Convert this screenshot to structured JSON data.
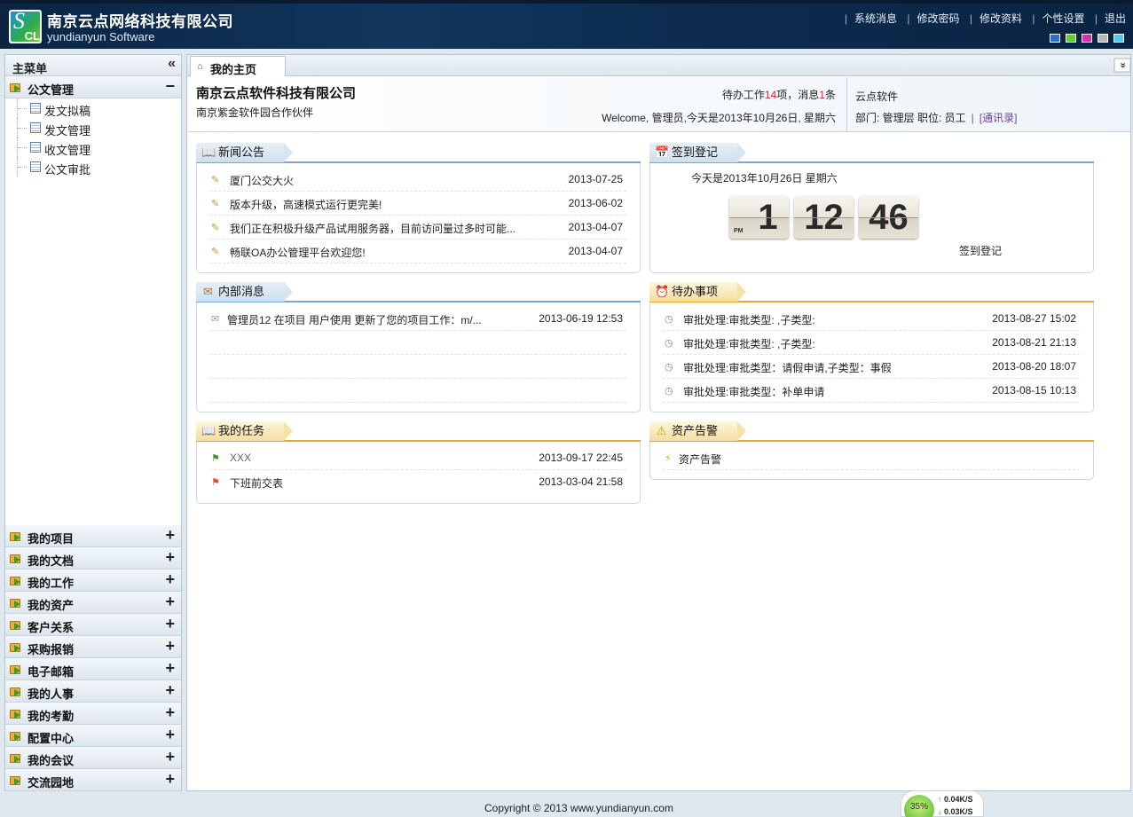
{
  "header": {
    "company_name": "南京云点网络科技有限公司",
    "company_sub": "yundianyun Software",
    "logo_text": "CL",
    "links": [
      "系统消息",
      "修改密码",
      "修改资料",
      "个性设置",
      "退出"
    ],
    "skin_colors": [
      "#2a6fd0",
      "#5fcf2e",
      "#d62fb8",
      "#b8b8b8",
      "#4fc9f0"
    ]
  },
  "sidebar": {
    "title": "主菜单",
    "collapse_icon": "«",
    "open_group": {
      "label": "公文管理",
      "toggle": "−",
      "items": [
        "发文拟稿",
        "发文管理",
        "收文管理",
        "公文审批"
      ]
    },
    "groups": [
      "我的项目",
      "我的文档",
      "我的工作",
      "我的资产",
      "客户关系",
      "采购报销",
      "电子邮箱",
      "我的人事",
      "我的考勤",
      "配置中心",
      "我的会议",
      "交流园地"
    ],
    "expand_icon": "+"
  },
  "tabs": {
    "active": "我的主页",
    "dropdown_icon": "»"
  },
  "info": {
    "company": "南京云点软件科技有限公司",
    "partner": "南京紫金软件园合作伙伴",
    "todo_prefix": "待办工作",
    "todo_count": "14",
    "todo_mid": "项，消息",
    "msg_count": "1",
    "msg_suffix": "条",
    "welcome": "Welcome, 管理员,今天是2013年10月26日, 星期六",
    "org": "云点软件",
    "dept_pos": "部门: 管理层 职位: 员工",
    "contacts_link": "[通讯录]"
  },
  "news": {
    "title": "新闻公告",
    "items": [
      {
        "text": "厦门公交大火",
        "date": "2013-07-25"
      },
      {
        "text": "版本升级，高速模式运行更完美!",
        "date": "2013-06-02"
      },
      {
        "text": "我们正在积极升级产品试用服务器，目前访问量过多时可能...",
        "date": "2013-04-07"
      },
      {
        "text": "畅联OA办公管理平台欢迎您!",
        "date": "2013-04-07"
      }
    ]
  },
  "checkin": {
    "title": "签到登记",
    "today": "今天是2013年10月26日 星期六",
    "hour": "1",
    "minute": "12",
    "second": "46",
    "ampm": "PM",
    "button": "签到登记"
  },
  "messages": {
    "title": "内部消息",
    "items": [
      {
        "text": "管理员12 在项目 用户使用 更新了您的项目工作：m/...",
        "date": "2013-06-19 12:53"
      }
    ]
  },
  "todos": {
    "title": "待办事项",
    "items": [
      {
        "text": "审批处理:审批类型: ,子类型:",
        "date": "2013-08-27 15:02"
      },
      {
        "text": "审批处理:审批类型: ,子类型:",
        "date": "2013-08-21 21:13"
      },
      {
        "text": "审批处理:审批类型：请假申请,子类型：事假",
        "date": "2013-08-20 18:07"
      },
      {
        "text": "审批处理:审批类型：补单申请",
        "date": "2013-08-15 10:13"
      }
    ]
  },
  "tasks": {
    "title": "我的任务",
    "items": [
      {
        "text": "XXX",
        "date": "2013-09-17 22:45",
        "flag_color": "#3a9a2c"
      },
      {
        "text": "下班前交表",
        "date": "2013-03-04 21:58",
        "flag_color": "#e0502a"
      }
    ]
  },
  "assets": {
    "title": "资产告警",
    "items": [
      {
        "text": "资产告警"
      }
    ]
  },
  "footer": {
    "copyright": "Copyright © 2013 www.yundianyun.com",
    "speed_pct": "35%",
    "speed_up": "0.04K/S",
    "speed_down": "0.03K/S"
  }
}
